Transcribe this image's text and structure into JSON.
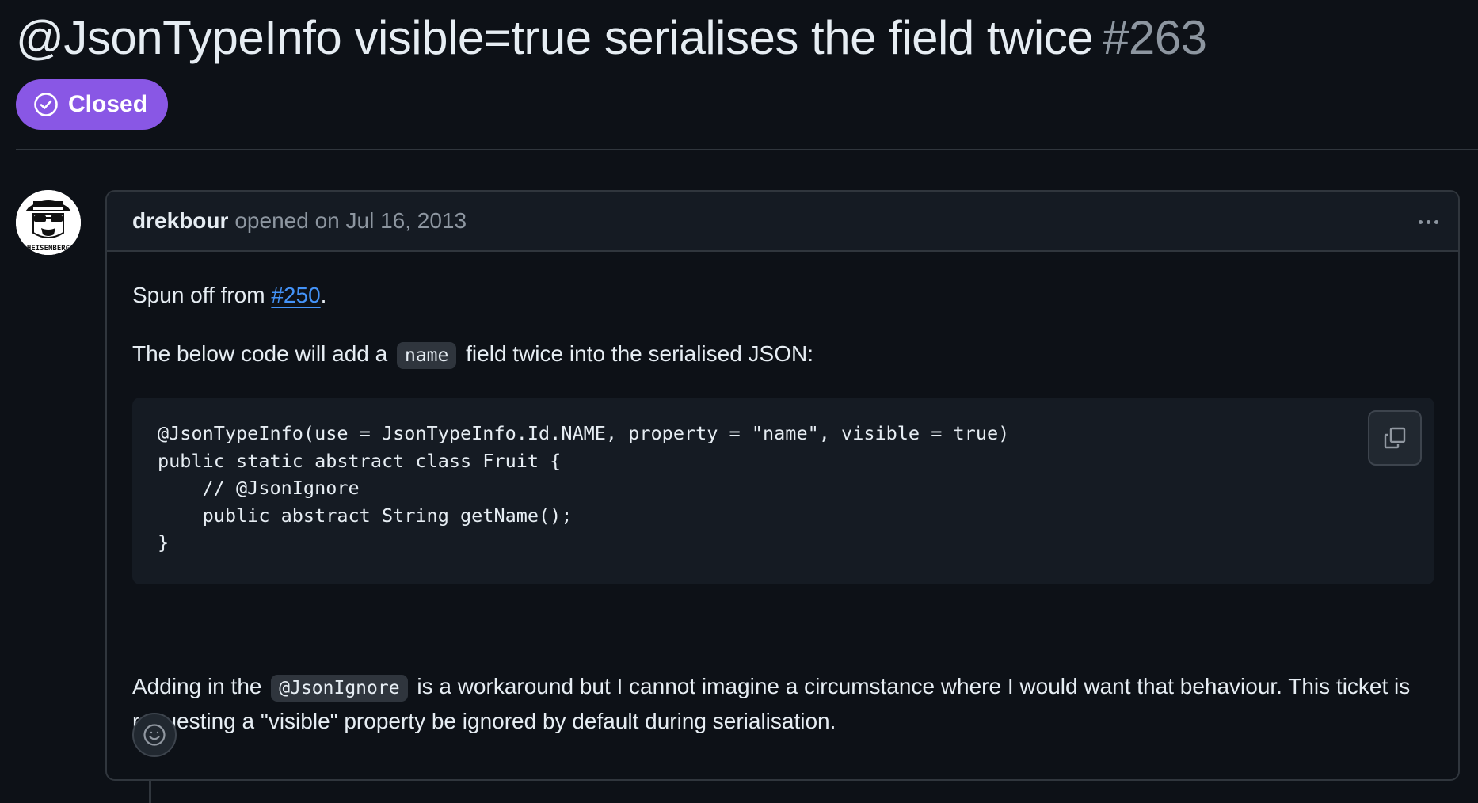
{
  "issue": {
    "title": "@JsonTypeInfo visible=true serialises the field twice",
    "number": "#263",
    "state": "Closed",
    "state_color": "#8957e5"
  },
  "comment": {
    "author": "drekbour",
    "meta": "opened on Jul 16, 2013",
    "avatar_text": "HEISENBERG",
    "para1_prefix": "Spun off from ",
    "para1_link": "#250",
    "para1_suffix": ".",
    "para2_prefix": "The below code will add a",
    "para2_code": "name",
    "para2_suffix": "field twice into the serialised JSON:",
    "code_lines": [
      "@JsonTypeInfo(use = JsonTypeInfo.Id.NAME, property = \"name\", visible = true)",
      "public static abstract class Fruit {",
      "    // @JsonIgnore",
      "    public abstract String getName();",
      "}"
    ],
    "para3_prefix": "Adding in the",
    "para3_code": "@JsonIgnore",
    "para3_suffix": "is a workaround but I cannot imagine a circumstance where I would want that behaviour. This ticket is requesting a \"visible\" property be ignored by default during serialisation."
  },
  "icons": {
    "state": "check-circle-icon",
    "copy": "copy-icon",
    "reaction": "smiley-icon",
    "menu": "kebab-horizontal-icon"
  },
  "colors": {
    "background": "#0d1117",
    "link": "#4493f8",
    "muted": "#8d96a0",
    "border": "#30363d"
  }
}
